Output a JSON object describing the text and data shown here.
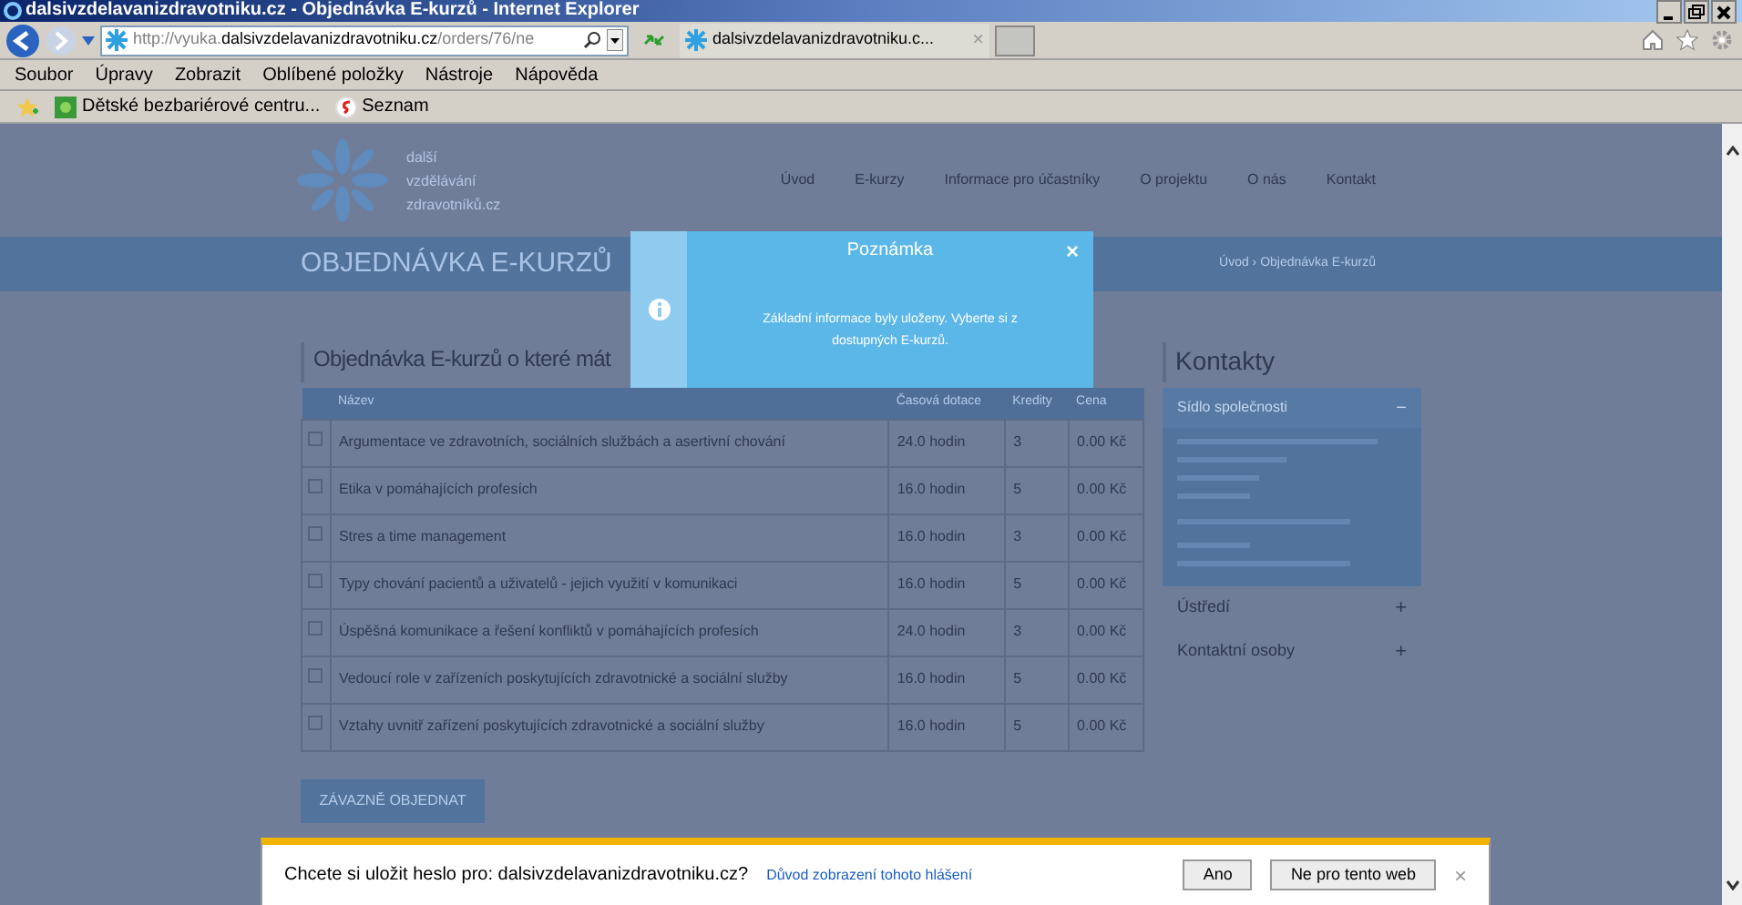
{
  "window": {
    "title": "dalsivzdelavanizdravotniku.cz - Objednávka E-kurzů - Internet Explorer"
  },
  "address_bar": {
    "url_prefix": "http://vyuka.",
    "url_domain": "dalsivzdelavanizdravotniku.cz",
    "url_path": "/orders/76/ne"
  },
  "tab": {
    "title": "dalsivzdelavanizdravotniku.c...",
    "close": "×"
  },
  "menu": [
    "Soubor",
    "Úpravy",
    "Zobrazit",
    "Oblíbené položky",
    "Nástroje",
    "Nápověda"
  ],
  "favorites": [
    "Dětské bezbariérové centru...",
    "Seznam"
  ],
  "site": {
    "logo_lines": [
      "další",
      "vzdělávání",
      "zdravotníků.cz"
    ],
    "nav": [
      "Úvod",
      "E-kurzy",
      "Informace pro účastníky",
      "O projektu",
      "O nás",
      "Kontakt"
    ],
    "page_title": "OBJEDNÁVKA E-KURZŮ",
    "breadcrumb": "Úvod  ›  Objednávka E-kurzů",
    "section_title": "Objednávka E-kurzů o které mát",
    "table": {
      "columns": [
        "Název",
        "Časová dotace",
        "Kredity",
        "Cena"
      ],
      "rows": [
        {
          "checked": false,
          "name": "Argumentace ve zdravotních, sociálních službách a asertivní chování",
          "hours": "24.0 hodin",
          "credits": "3",
          "price": "0.00 Kč"
        },
        {
          "checked": false,
          "name": "Etika v pomáhajících profesích",
          "hours": "16.0 hodin",
          "credits": "5",
          "price": "0.00 Kč"
        },
        {
          "checked": false,
          "name": "Stres a time management",
          "hours": "16.0 hodin",
          "credits": "3",
          "price": "0.00 Kč"
        },
        {
          "checked": false,
          "name": "Typy chování pacientů a uživatelů - jejich využití v komunikaci",
          "hours": "16.0 hodin",
          "credits": "5",
          "price": "0.00 Kč"
        },
        {
          "checked": false,
          "name": "Úspěšná komunikace a řešení konfliktů v pomáhajících profesích",
          "hours": "24.0 hodin",
          "credits": "3",
          "price": "0.00 Kč"
        },
        {
          "checked": false,
          "name": "Vedoucí role v zařízeních poskytujících zdravotnické a sociální služby",
          "hours": "16.0 hodin",
          "credits": "5",
          "price": "0.00 Kč"
        },
        {
          "checked": false,
          "name": "Vztahy uvnitř zařízení poskytujících zdravotnické a sociální služby",
          "hours": "16.0 hodin",
          "credits": "5",
          "price": "0.00 Kč"
        }
      ]
    },
    "order_button": "ZÁVAZNĚ OBJEDNAT",
    "contacts": {
      "title": "Kontakty",
      "sections": [
        {
          "label": "Sídlo společnosti",
          "expanded": true,
          "icon": "−"
        },
        {
          "label": "Ústředí",
          "expanded": false,
          "icon": "+"
        },
        {
          "label": "Kontaktní osoby",
          "expanded": false,
          "icon": "+"
        }
      ]
    }
  },
  "modal": {
    "title": "Poznámka",
    "close": "×",
    "message": "Základní informace byly uloženy. Vyberte si z dostupných E-kurzů."
  },
  "notification": {
    "message": "Chcete si uložit heslo pro: dalsivzdelavanizdravotniku.cz?",
    "link": "Důvod zobrazení tohoto hlášení",
    "buttons": [
      "Ano",
      "Ne pro tento web"
    ],
    "close": "×"
  }
}
